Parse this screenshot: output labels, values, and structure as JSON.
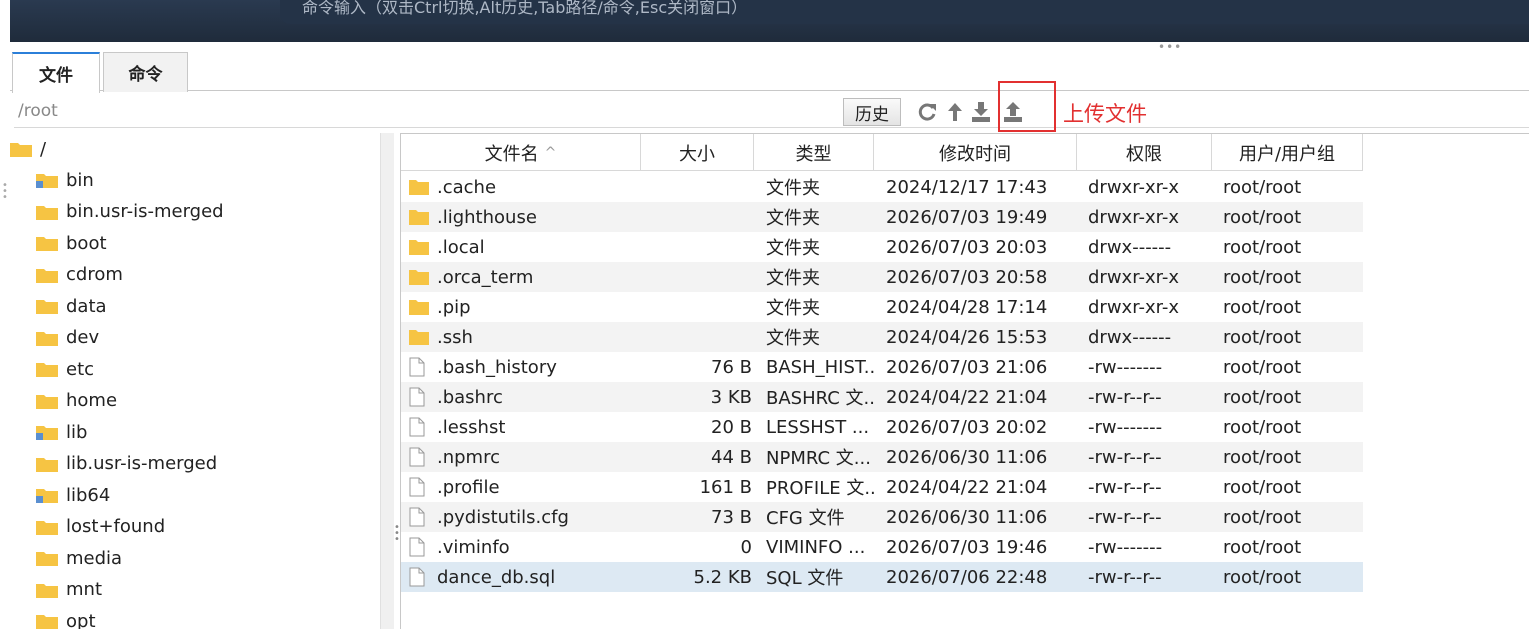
{
  "terminal": {
    "hint": "命令输入（双击Ctrl切换,Alt历史,Tab路径/命令,Esc关闭窗口）"
  },
  "tabs": [
    {
      "label": "文件",
      "active": true
    },
    {
      "label": "命令",
      "active": false
    }
  ],
  "pathbar": {
    "path": "/root",
    "history_label": "历史",
    "icons": [
      "refresh-icon",
      "up-directory-icon",
      "download-icon",
      "upload-icon"
    ]
  },
  "annotation": {
    "label": "上传文件",
    "color": "#e23030"
  },
  "tree": {
    "root": "/",
    "items": [
      {
        "name": "bin",
        "link": true
      },
      {
        "name": "bin.usr-is-merged",
        "link": false
      },
      {
        "name": "boot",
        "link": false
      },
      {
        "name": "cdrom",
        "link": false
      },
      {
        "name": "data",
        "link": false
      },
      {
        "name": "dev",
        "link": false
      },
      {
        "name": "etc",
        "link": false
      },
      {
        "name": "home",
        "link": false
      },
      {
        "name": "lib",
        "link": true
      },
      {
        "name": "lib.usr-is-merged",
        "link": false
      },
      {
        "name": "lib64",
        "link": true
      },
      {
        "name": "lost+found",
        "link": false
      },
      {
        "name": "media",
        "link": false
      },
      {
        "name": "mnt",
        "link": false
      },
      {
        "name": "opt",
        "link": false
      }
    ]
  },
  "table": {
    "columns": [
      "文件名",
      "大小",
      "类型",
      "修改时间",
      "权限",
      "用户/用户组"
    ],
    "sort_indicator": "^",
    "rows": [
      {
        "name": ".cache",
        "size": "",
        "type": "文件夹",
        "mtime": "2024/12/17 17:43",
        "perm": "drwxr-xr-x",
        "owner": "root/root",
        "folder": true
      },
      {
        "name": ".lighthouse",
        "size": "",
        "type": "文件夹",
        "mtime": "2026/07/03 19:49",
        "perm": "drwxr-xr-x",
        "owner": "root/root",
        "folder": true
      },
      {
        "name": ".local",
        "size": "",
        "type": "文件夹",
        "mtime": "2026/07/03 20:03",
        "perm": "drwx------",
        "owner": "root/root",
        "folder": true
      },
      {
        "name": ".orca_term",
        "size": "",
        "type": "文件夹",
        "mtime": "2026/07/03 20:58",
        "perm": "drwxr-xr-x",
        "owner": "root/root",
        "folder": true
      },
      {
        "name": ".pip",
        "size": "",
        "type": "文件夹",
        "mtime": "2024/04/28 17:14",
        "perm": "drwxr-xr-x",
        "owner": "root/root",
        "folder": true
      },
      {
        "name": ".ssh",
        "size": "",
        "type": "文件夹",
        "mtime": "2024/04/26 15:53",
        "perm": "drwx------",
        "owner": "root/root",
        "folder": true
      },
      {
        "name": ".bash_history",
        "size": "76 B",
        "type": "BASH_HIST...",
        "mtime": "2026/07/03 21:06",
        "perm": "-rw-------",
        "owner": "root/root",
        "folder": false
      },
      {
        "name": ".bashrc",
        "size": "3 KB",
        "type": "BASHRC 文...",
        "mtime": "2024/04/22 21:04",
        "perm": "-rw-r--r--",
        "owner": "root/root",
        "folder": false
      },
      {
        "name": ".lesshst",
        "size": "20 B",
        "type": "LESSHST ...",
        "mtime": "2026/07/03 20:02",
        "perm": "-rw-------",
        "owner": "root/root",
        "folder": false
      },
      {
        "name": ".npmrc",
        "size": "44 B",
        "type": "NPMRC 文...",
        "mtime": "2026/06/30 11:06",
        "perm": "-rw-r--r--",
        "owner": "root/root",
        "folder": false
      },
      {
        "name": ".profile",
        "size": "161 B",
        "type": "PROFILE 文...",
        "mtime": "2024/04/22 21:04",
        "perm": "-rw-r--r--",
        "owner": "root/root",
        "folder": false
      },
      {
        "name": ".pydistutils.cfg",
        "size": "73 B",
        "type": "CFG 文件",
        "mtime": "2026/06/30 11:06",
        "perm": "-rw-r--r--",
        "owner": "root/root",
        "folder": false
      },
      {
        "name": ".viminfo",
        "size": "0",
        "type": "VIMINFO ...",
        "mtime": "2026/07/03 19:46",
        "perm": "-rw-------",
        "owner": "root/root",
        "folder": false
      },
      {
        "name": "dance_db.sql",
        "size": "5.2 KB",
        "type": "SQL 文件",
        "mtime": "2026/07/06 22:48",
        "perm": "-rw-r--r--",
        "owner": "root/root",
        "folder": false,
        "selected": true
      }
    ]
  },
  "colors": {
    "accent": "#2b7fd9",
    "folder": "#f6c443",
    "selected_row": "#dde9f3"
  }
}
